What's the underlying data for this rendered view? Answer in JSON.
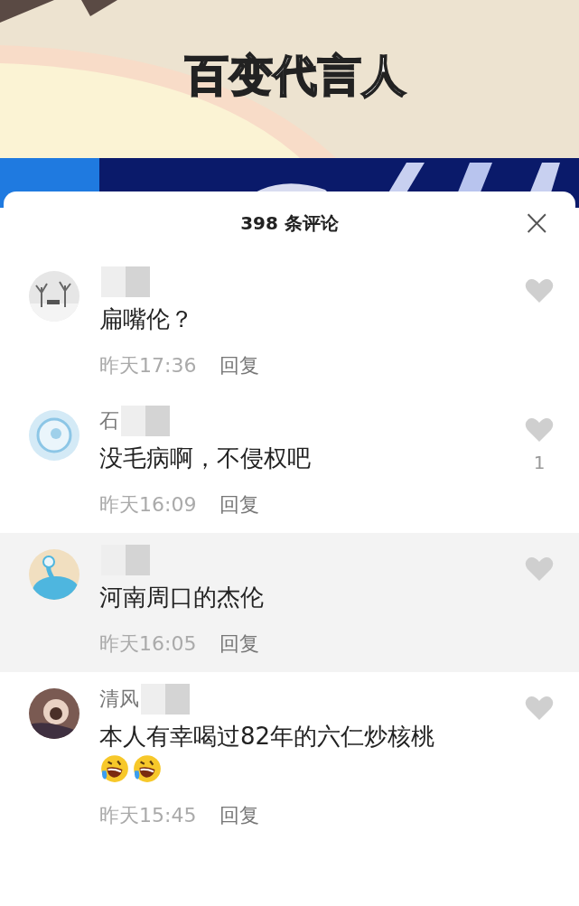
{
  "video": {
    "kind": "picture",
    "title": "百变代言人"
  },
  "comments_panel": {
    "title": "398 条评论",
    "close": "×",
    "comments": [
      {
        "name_blurred": true,
        "text": "扁嘴伦？",
        "time": "昨天17:36",
        "reply": "回复",
        "highlighted": false
      },
      {
        "name": "石",
        "name_blurred": true,
        "text": "没毛病啊，不侵权吧",
        "time": "昨天16:09",
        "reply": "回复",
        "likes": "1",
        "highlighted": false
      },
      {
        "name_blurred": true,
        "text": "河南周口的杰伦",
        "time": "昨天16:05",
        "reply": "回复",
        "highlighted": true
      },
      {
        "name": "清风",
        "name_blurred": true,
        "text": "本人有幸喝过82年的六仁炒核桃",
        "emojis": [
          {
            "kind": "laughing-crying"
          },
          {
            "kind": "laughing-crying"
          }
        ],
        "time": "昨天15:45",
        "reply": "回复",
        "highlighted": false
      }
    ]
  }
}
